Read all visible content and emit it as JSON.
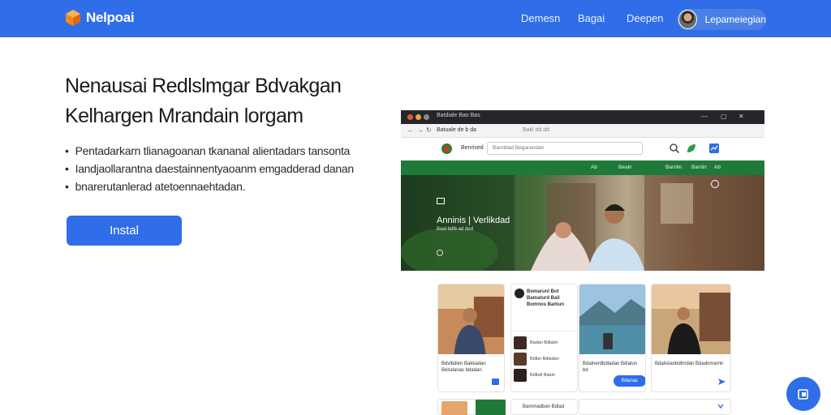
{
  "header": {
    "brand": "Nelpoai",
    "nav": [
      "Demesn",
      "Bagai",
      "Deepen"
    ],
    "user_name": "Lepameiegian"
  },
  "hero": {
    "title_line1": "Nenausai Redlslmgar Bdvakgan",
    "title_line2": "Kelhargen Mrandain lorgam",
    "bullets": [
      "Pentadarkarn tlianagoanan tkananal alientadars tansonta",
      "Iandjaollarantna daestainnentyaoanm emgadderad danan",
      "bnarerutanlerad atetoennaehtadan."
    ],
    "install_label": "Instal"
  },
  "browser": {
    "title": "Batdiale Bao Bas",
    "url": "Batuale de b da",
    "url_hint": "Bakl dd dd",
    "site_name": "Benrised",
    "search_placeholder": "Banrldad Begarandan",
    "green_nav": [
      "Ab",
      "Bealn",
      "Barnlin",
      "Barrlin",
      "Ab"
    ],
    "hero_caption": "Anninis | Verlikdad",
    "hero_subcaption": "Baal bdlb ad ded",
    "cards": [
      {
        "text": "Bdvlbdlen Bakkadan Belsdanas bdadan"
      },
      {
        "header": "Bomarunl Bot Bamaturd Bail Bomnos Bamun",
        "rows": [
          "Badan Bdlabn",
          "Bdlbn Bdladan",
          "Bdlbdl Bdaln"
        ]
      },
      {
        "text": "Bdalnerdbdladan Bdlalun bd",
        "pill": "Bdanas"
      },
      {
        "text": "Bdalvdanbdlnrdan Bdadnmarnlr"
      }
    ],
    "bottom_card": "Bammadban Bdlad"
  },
  "colors": {
    "primary": "#2f6ee8",
    "green_nav": "#1f7a3a"
  }
}
